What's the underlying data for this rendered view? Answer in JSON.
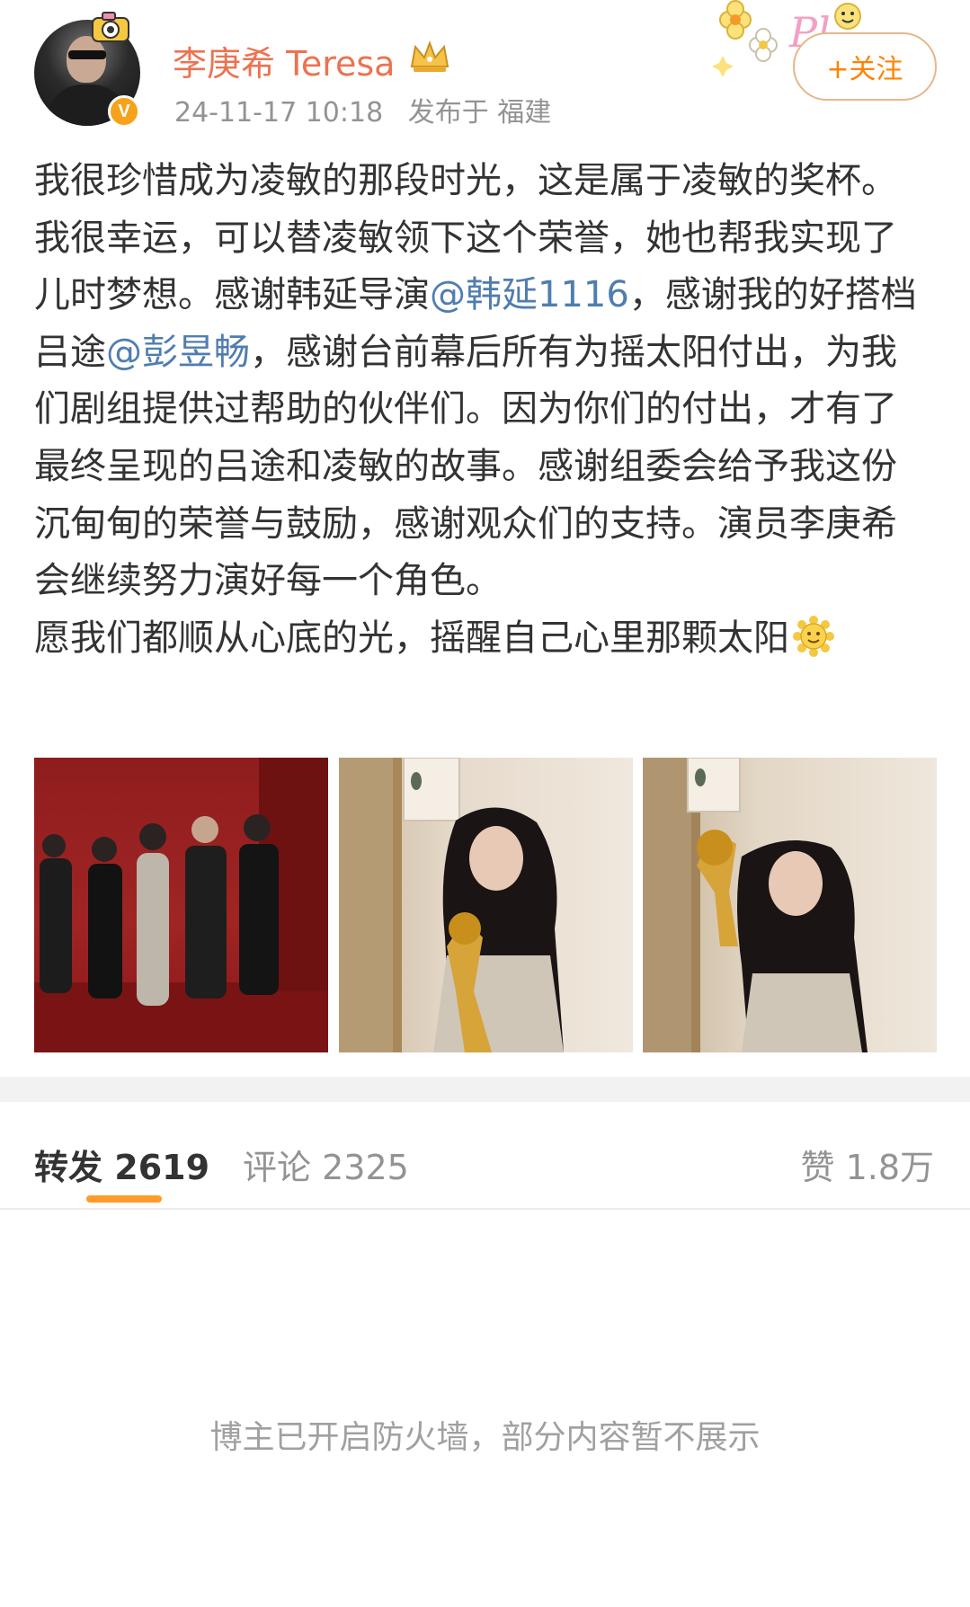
{
  "post": {
    "author": {
      "name": "李庚希 Teresa",
      "verified_badge": "V"
    },
    "timestamp": "24-11-17 10:18",
    "location": "发布于 福建",
    "follow_label": "+关注",
    "content": {
      "seg1": "我很珍惜成为凌敏的那段时光，这是属于凌敏的奖杯。我很幸运，可以替凌敏领下这个荣誉，她也帮我实现了儿时梦想。感谢韩延导演",
      "mention1": "@韩延1116",
      "seg2": "，感谢我的好搭档吕途",
      "mention2": "@彭昱畅",
      "seg3": "，感谢台前幕后所有为摇太阳付出，为我们剧组提供过帮助的伙伴们。因为你们的付出，才有了最终呈现的吕途和凌敏的故事。感谢组委会给予我这份沉甸甸的荣誉与鼓励，感谢观众们的支持。演员李庚希会继续努力演好每一个角色。",
      "seg4": "愿我们都顺从心底的光，摇醒自己心里那颗太阳",
      "emoji": "sun-emoji"
    },
    "photos": [
      "group-photo-red-carpet",
      "trophy-photo-1",
      "trophy-photo-2"
    ]
  },
  "stats": {
    "repost_label": "转发",
    "repost_count": "2619",
    "comment_label": "评论",
    "comment_count": "2325",
    "like_label": "赞",
    "like_count": "1.8万"
  },
  "notice": "博主已开启防火墙，部分内容暂不展示",
  "colors": {
    "username": "#eb7350",
    "mention": "#507daf",
    "accent": "#ff8200",
    "underline": "#ff9b2a"
  }
}
